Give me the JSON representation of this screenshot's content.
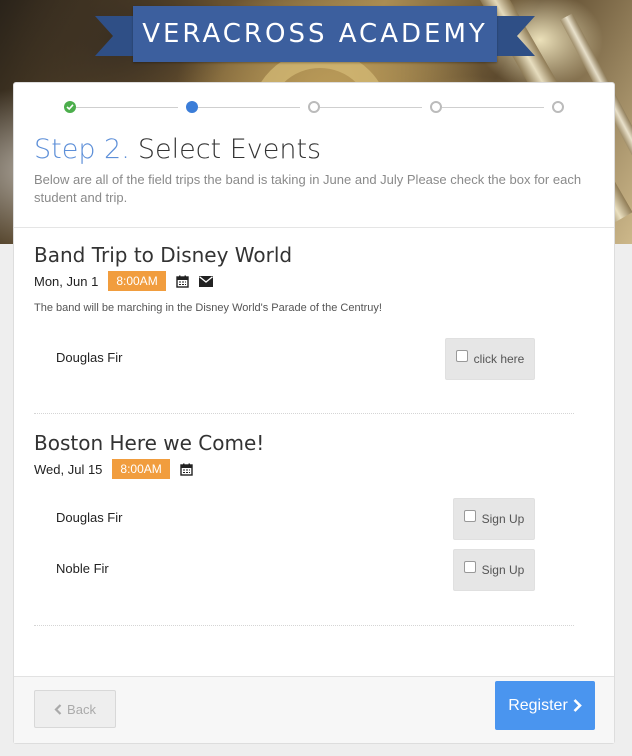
{
  "header": {
    "school_name": "VERACROSS ACADEMY"
  },
  "stepper": {
    "current_step": 2,
    "total_steps": 5
  },
  "step": {
    "number": "Step 2.",
    "title": "Select Events",
    "description": "Below are all of the field trips the band is taking in June and July Please check the box for each student and trip."
  },
  "events": [
    {
      "title": "Band Trip to Disney World",
      "date": "Mon, Jun 1",
      "time": "8:00AM",
      "description": "The band will be marching in the Disney World's Parade of the Centruy!",
      "students": [
        {
          "name": "Douglas Fir",
          "action_label": "click here"
        }
      ]
    },
    {
      "title": "Boston Here we Come!",
      "date": "Wed, Jul 15",
      "time": "8:00AM",
      "students": [
        {
          "name": "Douglas Fir",
          "action_label": "Sign Up"
        },
        {
          "name": "Noble Fir",
          "action_label": "Sign Up"
        }
      ]
    }
  ],
  "footer": {
    "back_label": "Back",
    "register_label": "Register"
  },
  "colors": {
    "banner": "#3c5f9e",
    "accent_blue": "#4a95ef",
    "time_badge": "#f19d3e",
    "done_green": "#4cae4c"
  }
}
